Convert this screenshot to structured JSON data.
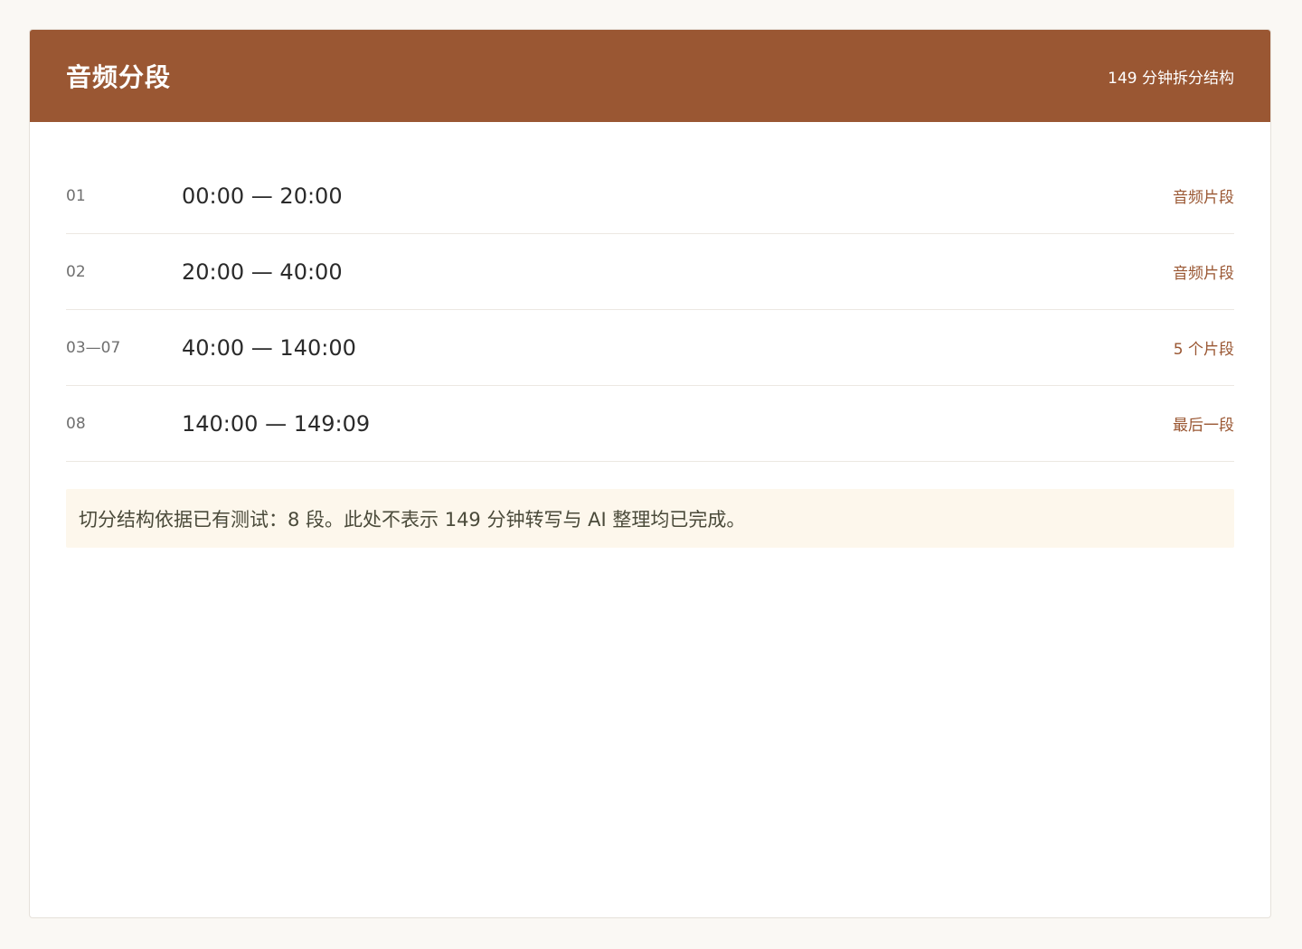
{
  "header": {
    "title": "音频分段",
    "subtitle": "149 分钟拆分结构"
  },
  "segments": [
    {
      "index": "01",
      "range": "00:00 — 20:00",
      "tag": "音频片段"
    },
    {
      "index": "02",
      "range": "20:00 — 40:00",
      "tag": "音频片段"
    },
    {
      "index": "03—07",
      "range": "40:00 — 140:00",
      "tag": "5 个片段"
    },
    {
      "index": "08",
      "range": "140:00 — 149:09",
      "tag": "最后一段"
    }
  ],
  "note": "切分结构依据已有测试：8 段。此处不表示 149 分钟转写与 AI 整理均已完成。",
  "colors": {
    "accent": "#9a5733",
    "note_background": "#fdf7ec",
    "page_background": "#faf8f4"
  }
}
